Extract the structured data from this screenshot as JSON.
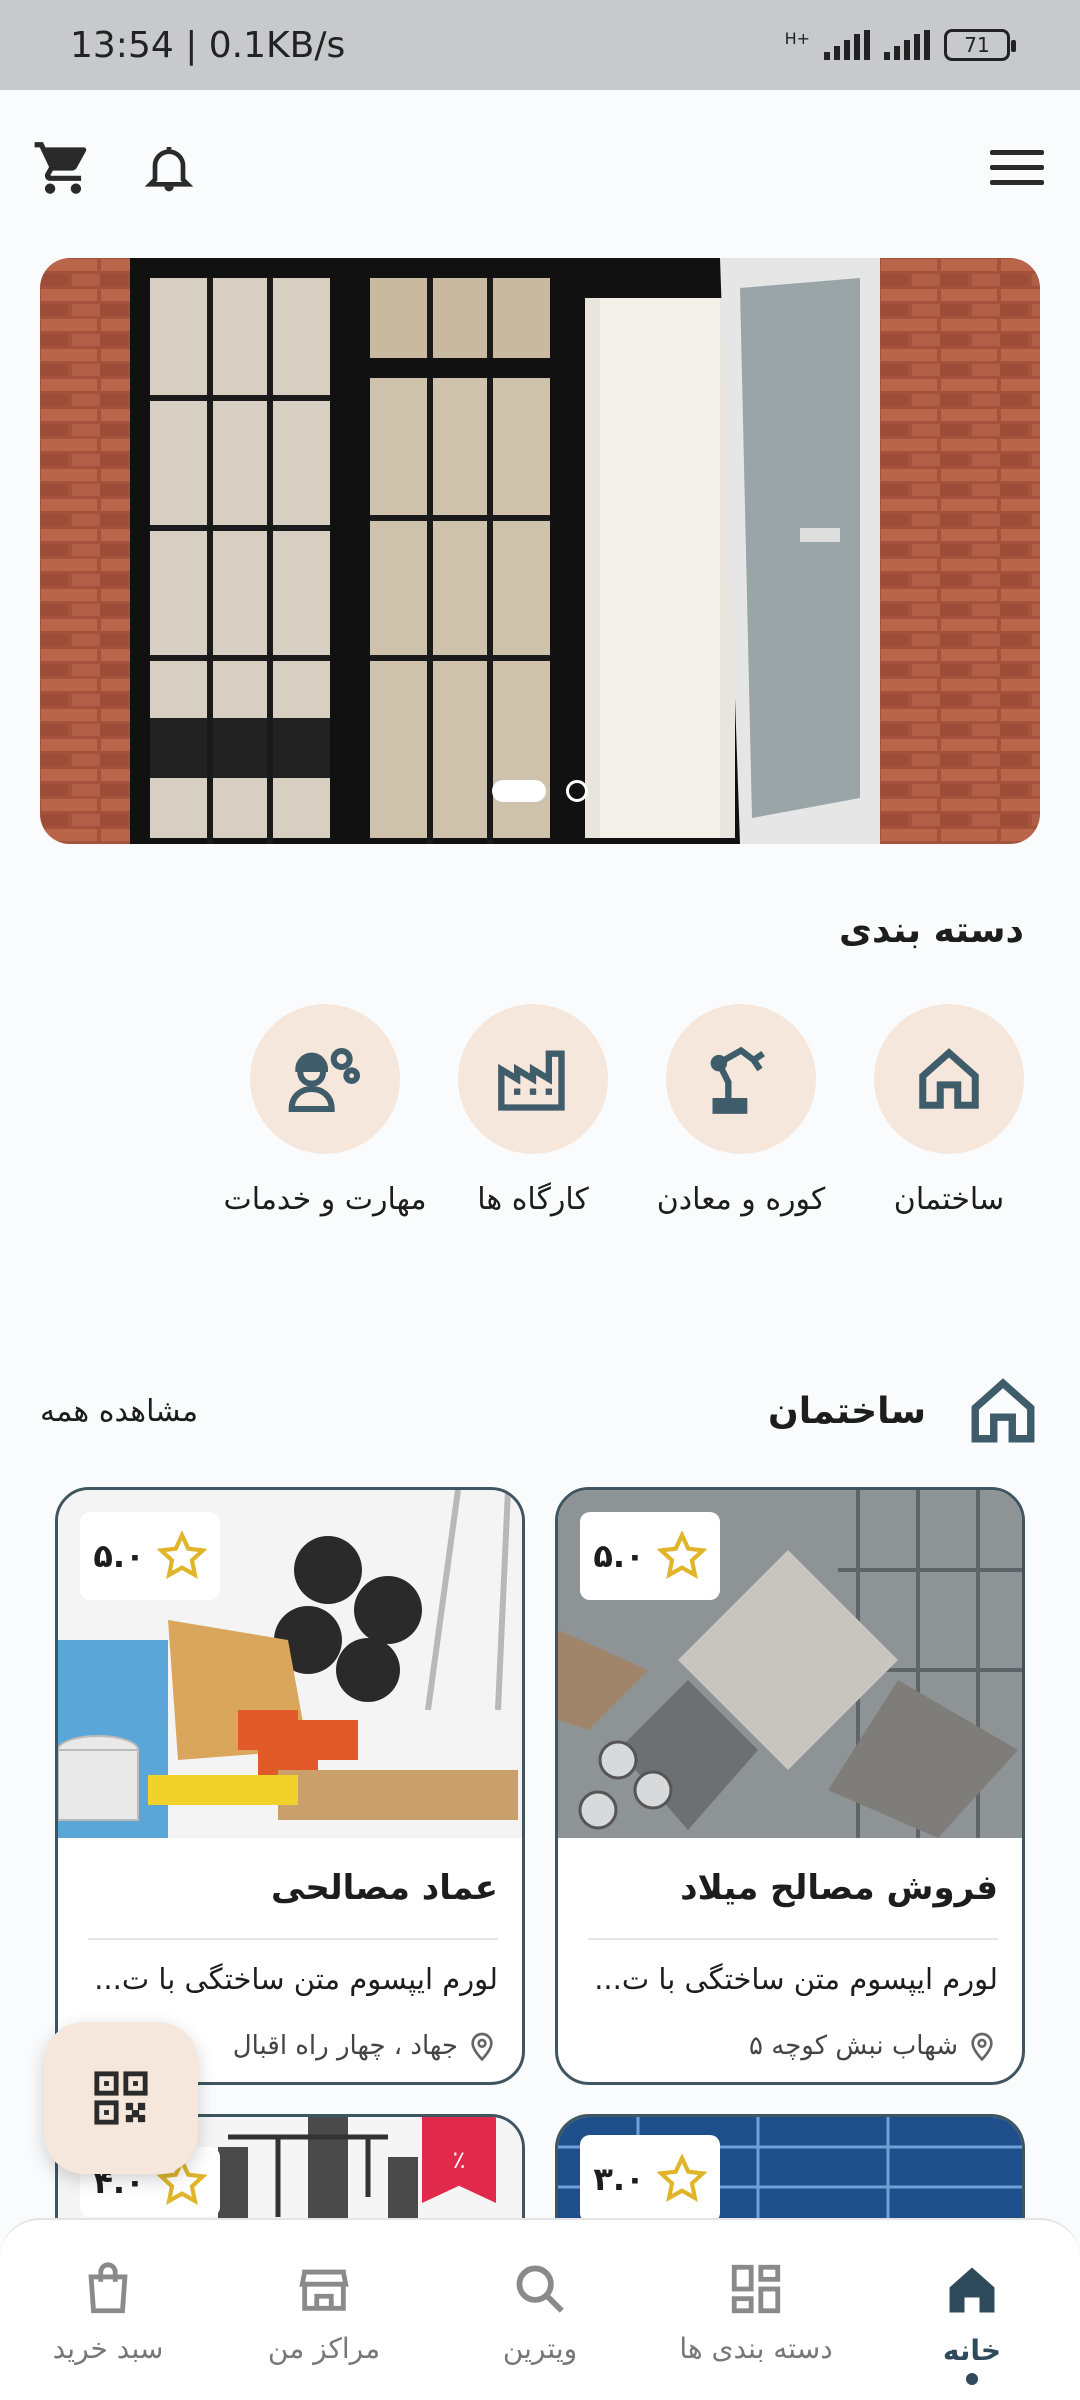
{
  "status_bar": {
    "time": "13:54 | 0.1KB/s",
    "network": "H+",
    "battery": "71"
  },
  "banner": {
    "slides": 2,
    "active_index": 0
  },
  "categories": {
    "title": "دسته بندی",
    "items": [
      {
        "label": "ساختمان",
        "icon": "home-icon"
      },
      {
        "label": "کوره و معادن",
        "icon": "robot-arm-icon"
      },
      {
        "label": "کارگاه ها",
        "icon": "factory-icon"
      },
      {
        "label": "مهارت و خدمات",
        "icon": "worker-gear-icon"
      }
    ]
  },
  "section": {
    "title": "ساختمان",
    "view_all": "مشاهده همه"
  },
  "cards": [
    {
      "name": "فروش مصالح میلاد",
      "rating": "۵.۰",
      "desc": "لورم ایپسوم متن ساختگی با ت...",
      "address": "شهاب نبش کوچه ۵"
    },
    {
      "name": "عماد مصالحی",
      "rating": "۵.۰",
      "desc": "لورم ایپسوم متن ساختگی با ت...",
      "address": "جهاد ، چهار راه اقبال"
    },
    {
      "rating": "۳.۰"
    },
    {
      "rating": "۴.۰",
      "discount": "٪"
    }
  ],
  "bottom_nav": [
    {
      "label": "خانه",
      "icon": "home-icon",
      "active": true
    },
    {
      "label": "دسته بندی ها",
      "icon": "grid-icon"
    },
    {
      "label": "ویترین",
      "icon": "search-icon"
    },
    {
      "label": "مراکز من",
      "icon": "store-icon"
    },
    {
      "label": "سبد خرید",
      "icon": "shopping-bag-icon"
    }
  ],
  "colors": {
    "accent": "#2f4b5b",
    "category_bg": "#f6e7dc",
    "discount": "#e0294b",
    "star": "#e0b52a"
  }
}
